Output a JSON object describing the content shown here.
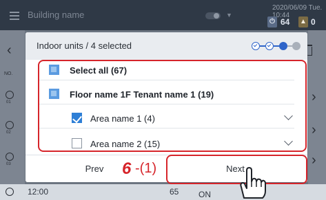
{
  "topbar": {
    "title": "Building name",
    "datetime": "2020/06/09 Tue. 10:44",
    "power_count": "64",
    "warning_count": "0"
  },
  "background": {
    "no_label": "NO.",
    "row_numbers": [
      "01",
      "02",
      "03"
    ],
    "bottom_time": "12:00",
    "bottom_value": "65",
    "bottom_status": "ON"
  },
  "dialog": {
    "title": "Indoor units / 4 selected",
    "steps": [
      "done",
      "done",
      "current",
      "todo"
    ],
    "rows": [
      {
        "label": "Select all (67)",
        "state": "partial",
        "bold": true,
        "indent": 0,
        "expandable": false
      },
      {
        "label": "Floor name 1F Tenant name 1 (19)",
        "state": "partial",
        "bold": true,
        "indent": 0,
        "expandable": false
      },
      {
        "label": "Area name 1 (4)",
        "state": "checked",
        "bold": false,
        "indent": 1,
        "expandable": true
      },
      {
        "label": "Area name 2 (15)",
        "state": "unchecked",
        "bold": false,
        "indent": 1,
        "expandable": true
      }
    ],
    "prev_label": "Prev",
    "next_label": "Next"
  },
  "annotation": {
    "step_number": "6",
    "sub_number": "-(1)",
    "color": "#d6242a"
  },
  "colors": {
    "accent": "#2e64c9",
    "checkbox": "#2e7fd6",
    "highlight": "#d6242a"
  }
}
